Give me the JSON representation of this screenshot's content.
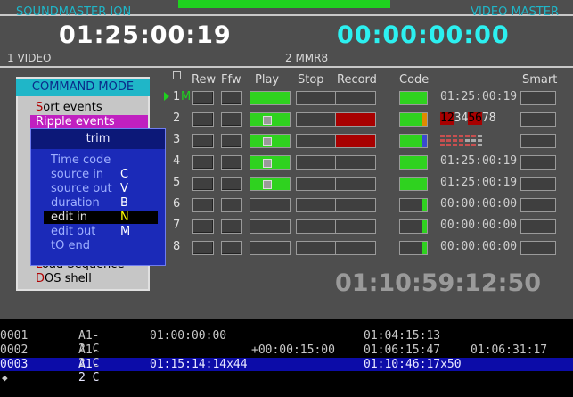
{
  "header": {
    "left_title": "SOUNDMASTER ION",
    "right_title": "VIDEO MASTER"
  },
  "panels": {
    "left": {
      "timecode": "01:25:00:19",
      "label": "1  VIDEO"
    },
    "right": {
      "timecode": "00:00:00:00",
      "label": "2  MMR8"
    },
    "big_timecode": "01:10:59:12:50"
  },
  "columns": {
    "rew": "Rew",
    "ffw": "Ffw",
    "play": "Play",
    "stop": "Stop",
    "record": "Record",
    "code": "Code",
    "smart": "Smart"
  },
  "rows": [
    {
      "num": "1",
      "marker": "M",
      "play_on": true,
      "play_dot": false,
      "rec_on": false,
      "code_side": "#2fd21f",
      "code_text": "01:25:00:19"
    },
    {
      "num": "2",
      "marker": "",
      "play_on": true,
      "play_dot": true,
      "rec_on": true,
      "code_side": "#e08a00",
      "code_text": ""
    },
    {
      "num": "3",
      "marker": "",
      "play_on": true,
      "play_dot": true,
      "rec_on": true,
      "code_side": "#3a4ad0",
      "code_text": ""
    },
    {
      "num": "4",
      "marker": "",
      "play_on": true,
      "play_dot": true,
      "rec_on": false,
      "code_side": "#2fd21f",
      "code_text": "01:25:00:19"
    },
    {
      "num": "5",
      "marker": "",
      "play_on": true,
      "play_dot": true,
      "rec_on": false,
      "code_side": "#2fd21f",
      "code_text": "01:25:00:19"
    },
    {
      "num": "6",
      "marker": "",
      "play_on": false,
      "play_dot": false,
      "rec_on": false,
      "code_side": "#2fd21f",
      "code_text": "00:00:00:00"
    },
    {
      "num": "7",
      "marker": "",
      "play_on": false,
      "play_dot": false,
      "rec_on": false,
      "code_side": "#2fd21f",
      "code_text": "00:00:00:00"
    },
    {
      "num": "8",
      "marker": "",
      "play_on": false,
      "play_dot": false,
      "rec_on": false,
      "code_side": "#2fd21f",
      "code_text": "00:00:00:00"
    }
  ],
  "track_digits": [
    "1",
    "2",
    "3",
    "4",
    "5",
    "6",
    "7",
    "8"
  ],
  "command_mode": {
    "title": "COMMAND MODE",
    "items": [
      {
        "hotkey": "S",
        "rest": "ort events"
      },
      {
        "hotkey": "R",
        "rest": "ipple events"
      },
      {
        "hotkey": "L",
        "rest": "oad Sequence"
      },
      {
        "hotkey": "D",
        "rest": "OS shell"
      }
    ]
  },
  "trim_menu": {
    "title": "trim",
    "items": [
      {
        "label": "Time code",
        "key": ""
      },
      {
        "label": "source in",
        "key": "C"
      },
      {
        "label": "source out",
        "key": "V"
      },
      {
        "label": "duration",
        "key": "B"
      },
      {
        "label": "edit in",
        "key": "N"
      },
      {
        "label": "edit out",
        "key": "M"
      },
      {
        "label": "tO end",
        "key": ""
      }
    ]
  },
  "edl": [
    {
      "n": "0001",
      "track": "A1-2 C",
      "a": "01:00:00:00",
      "b": "",
      "c": "01:04:15:13",
      "d": ""
    },
    {
      "n": "0002",
      "track": "A1-2 C",
      "a": "",
      "b": "+00:00:15:00",
      "c": "01:06:15:47",
      "d": "01:06:31:17"
    },
    {
      "n": "0003",
      "track": "A1-2 C",
      "a": "01:15:14:14x44",
      "b": "",
      "c": "01:10:46:17x50",
      "d": ""
    }
  ],
  "prompt": "◆"
}
